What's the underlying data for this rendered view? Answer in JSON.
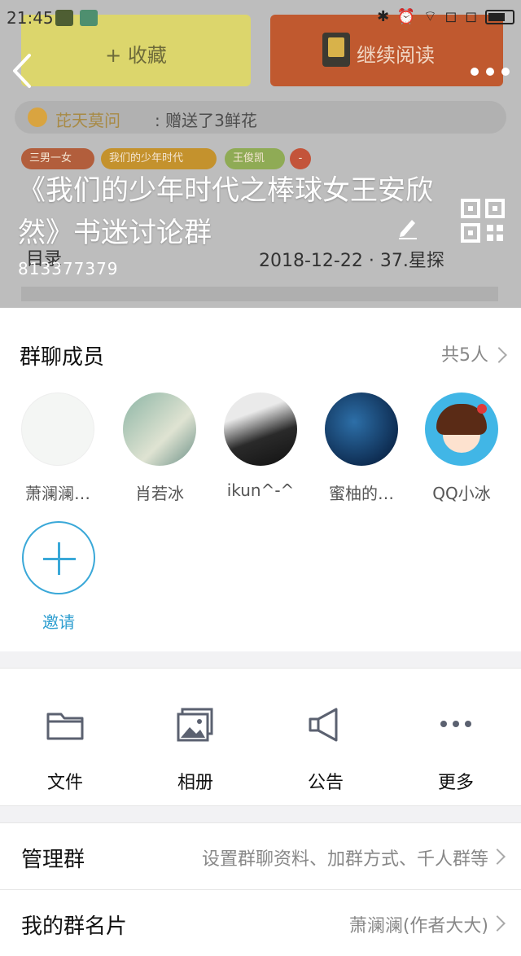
{
  "status_bar": {
    "time": "21:45",
    "right_icons": "✱ ⏰ ⌔ ◻ ◻"
  },
  "background": {
    "favorite_label": "+ 收藏",
    "continue_label": "继续阅读",
    "gift_name": "芘天莫问",
    "gift_text": ": 赠送了3鲜花",
    "tags": [
      "三男一女",
      "我们的少年时代",
      "王俊凯",
      "-"
    ],
    "toc_label": "目录",
    "update_info": "2018-12-22 · 37.星探"
  },
  "header": {
    "title": "《我们的少年时代之棒球女王安欣然》书迷讨论群",
    "group_id": "813377379"
  },
  "members": {
    "title": "群聊成员",
    "count_label": "共5人",
    "list": [
      {
        "name": "萧澜澜…"
      },
      {
        "name": "肖若冰"
      },
      {
        "name": "ikun^-^"
      },
      {
        "name": "蜜柚的…"
      },
      {
        "name": "QQ小冰"
      }
    ],
    "invite_label": "邀请"
  },
  "actions": {
    "files": "文件",
    "album": "相册",
    "announcement": "公告",
    "more": "更多"
  },
  "rows": {
    "manage_label": "管理群",
    "manage_value": "设置群聊资料、加群方式、千人群等",
    "card_label": "我的群名片",
    "card_value": "萧澜澜(作者大大)"
  },
  "colors": {
    "accent": "#3aa8d8",
    "header_bg": "#bdbdbd"
  }
}
